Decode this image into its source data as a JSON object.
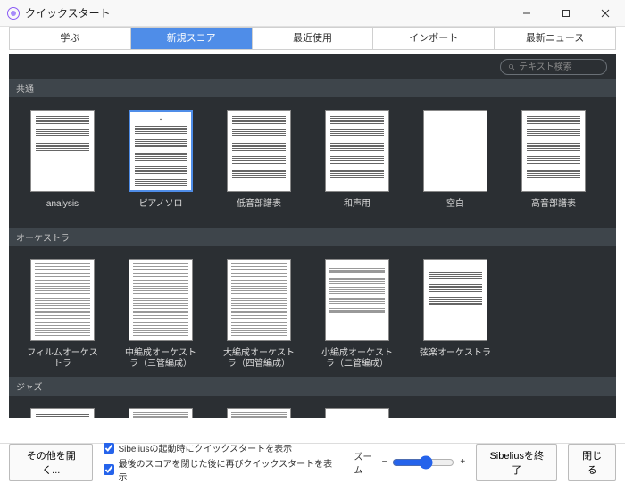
{
  "window": {
    "title": "クイックスタート"
  },
  "tabs": {
    "learn": "学ぶ",
    "new_score": "新規スコア",
    "recent": "最近使用",
    "import": "インポート",
    "news": "最新ニュース"
  },
  "search": {
    "placeholder": "テキスト検索"
  },
  "sections": {
    "common": {
      "label": "共通"
    },
    "orchestra": {
      "label": "オーケストラ"
    },
    "jazz": {
      "label": "ジャズ"
    }
  },
  "templates": {
    "common": [
      {
        "id": "analysis",
        "label": "analysis"
      },
      {
        "id": "piano_solo",
        "label": "ピアノソロ"
      },
      {
        "id": "bass_staff",
        "label": "低音部譜表"
      },
      {
        "id": "harmony",
        "label": "和声用"
      },
      {
        "id": "blank",
        "label": "空白"
      },
      {
        "id": "treble_staff",
        "label": "高音部譜表"
      }
    ],
    "orchestra": [
      {
        "id": "film_orch",
        "label": "フィルムオーケストラ"
      },
      {
        "id": "med_orch",
        "label": "中編成オーケストラ（三管編成）"
      },
      {
        "id": "large_orch",
        "label": "大編成オーケストラ（四管編成）"
      },
      {
        "id": "small_orch",
        "label": "小編成オーケストラ（二管編成）"
      },
      {
        "id": "string_orch",
        "label": "弦楽オーケストラ"
      }
    ]
  },
  "footer": {
    "open_other": "その他を開く...",
    "check_startup": "Sibeliusの起動時にクイックスタートを表示",
    "check_after_close": "最後のスコアを閉じた後に再びクイックスタートを表示",
    "zoom": "ズーム",
    "quit": "Sibeliusを終了",
    "close": "閉じる"
  }
}
